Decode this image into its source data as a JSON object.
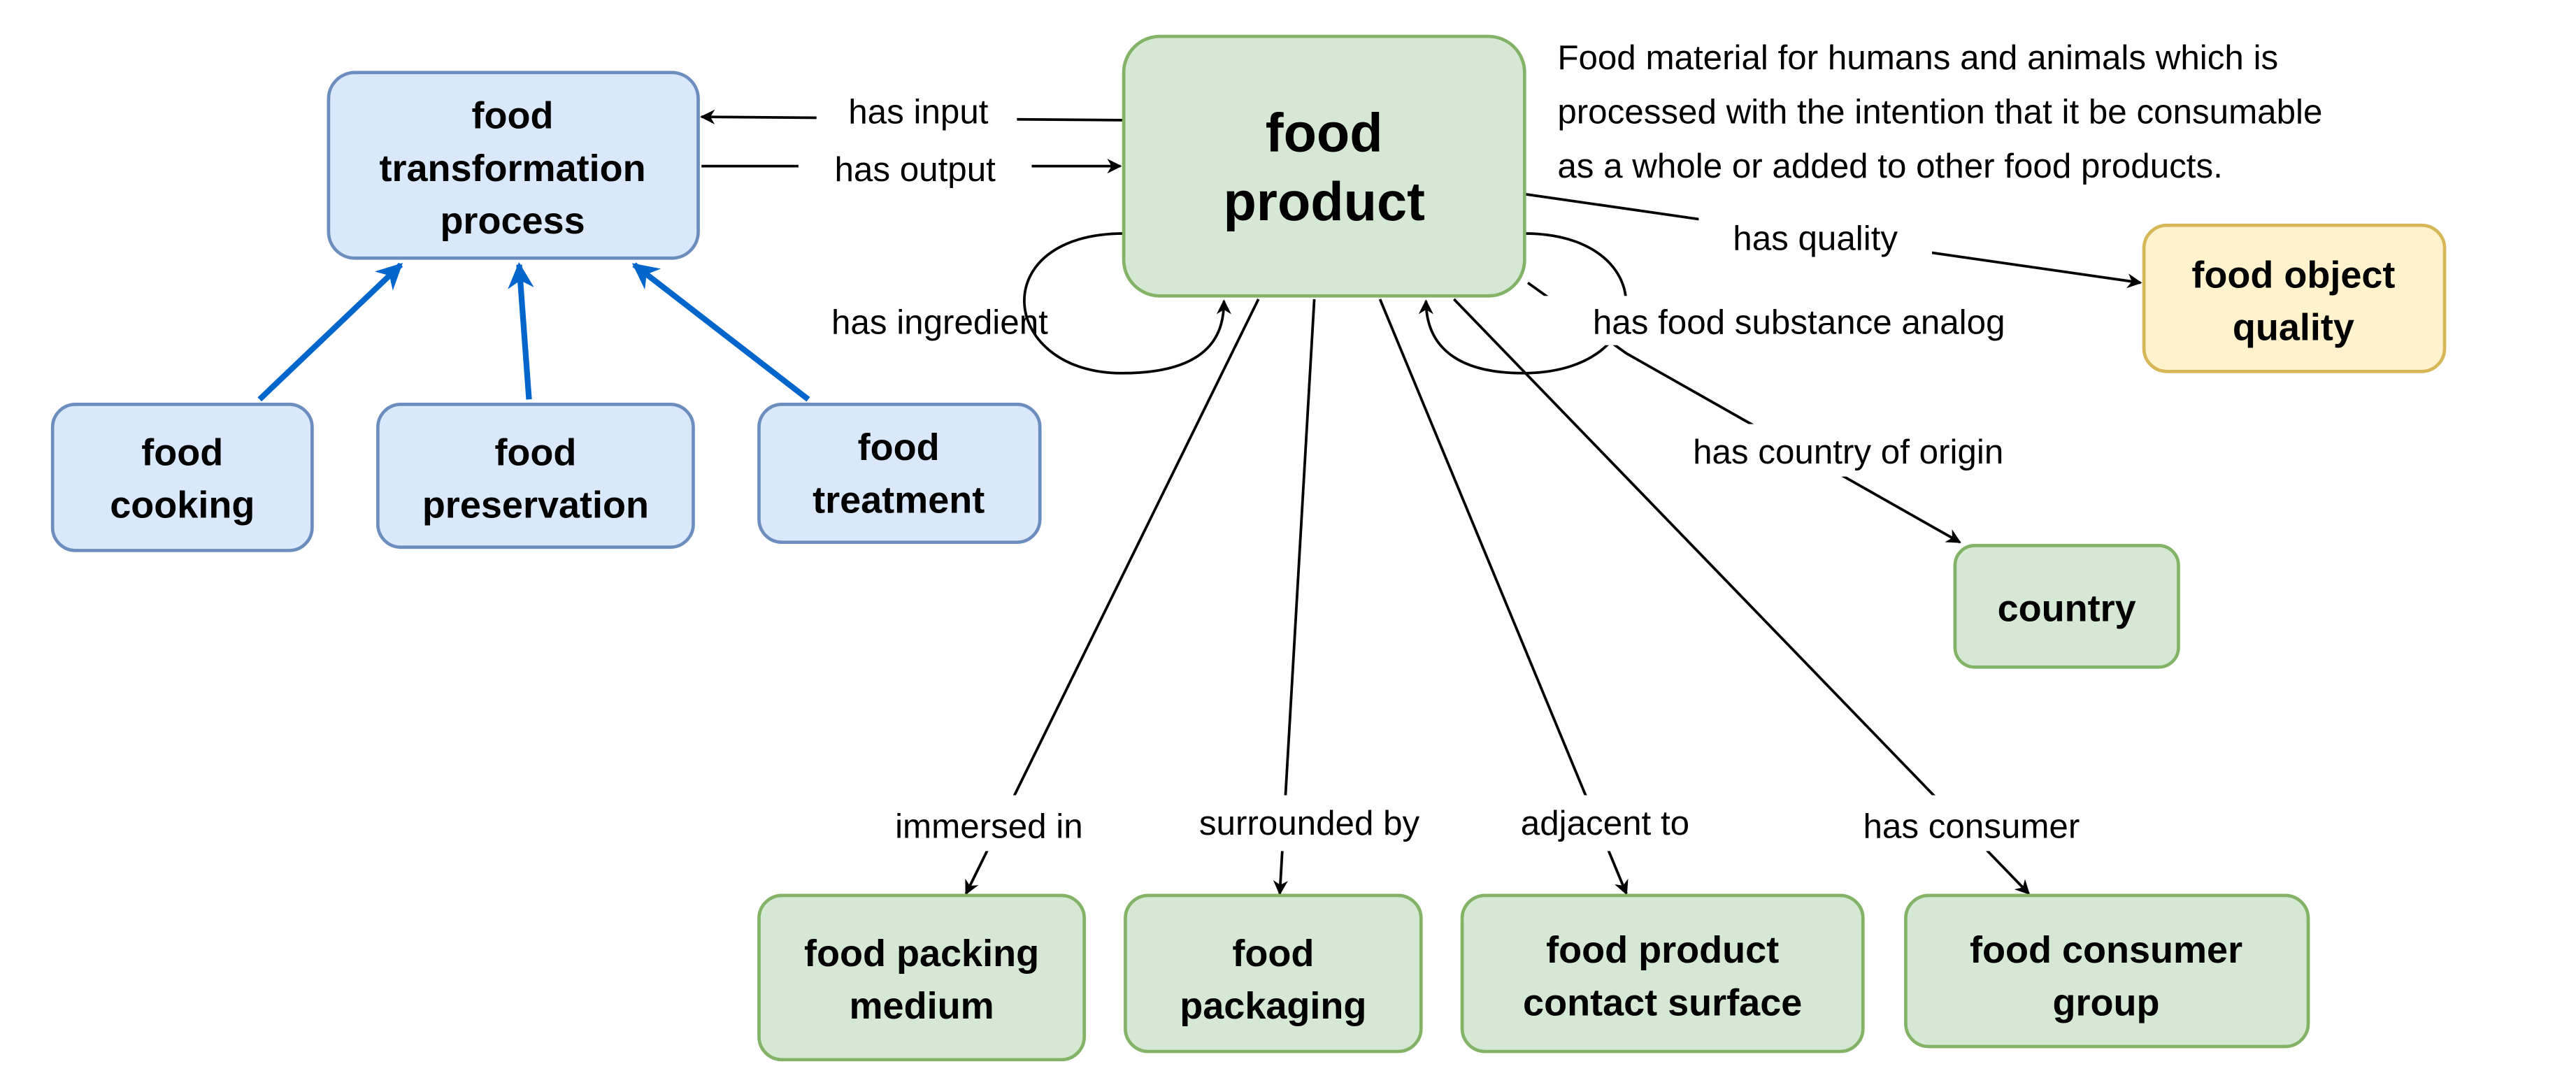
{
  "colors": {
    "process_fill": "#dae8fc",
    "process_stroke": "#6c8ebf",
    "entity_fill": "#d5e8d4",
    "entity_stroke": "#82b366",
    "quality_fill": "#fff2cc",
    "quality_stroke": "#d6b656",
    "subclass_arrow": "#0066cc"
  },
  "nodes": {
    "food_transformation_process": [
      "food",
      "transformation",
      "process"
    ],
    "food_cooking": [
      "food",
      "cooking"
    ],
    "food_preservation": [
      "food",
      "preservation"
    ],
    "food_treatment": [
      "food",
      "treatment"
    ],
    "food_product": [
      "food",
      "product"
    ],
    "food_object_quality": [
      "food object",
      "quality"
    ],
    "country": [
      "country"
    ],
    "food_packing_medium": [
      "food packing",
      "medium"
    ],
    "food_packaging": [
      "food",
      "packaging"
    ],
    "food_product_contact_surface": [
      "food product",
      "contact surface"
    ],
    "food_consumer_group": [
      "food consumer",
      "group"
    ]
  },
  "definition": [
    "Food material for humans and animals which is",
    "processed with the intention that it be consumable",
    "as a whole or added to other food products."
  ],
  "edges": {
    "has_input": "has input",
    "has_output": "has output",
    "has_quality": "has quality",
    "has_ingredient": "has ingredient",
    "has_food_substance_analog": "has food substance analog",
    "has_country_of_origin": "has country of origin",
    "immersed_in": "immersed in",
    "surrounded_by": "surrounded by",
    "adjacent_to": "adjacent to",
    "has_consumer": "has consumer"
  }
}
